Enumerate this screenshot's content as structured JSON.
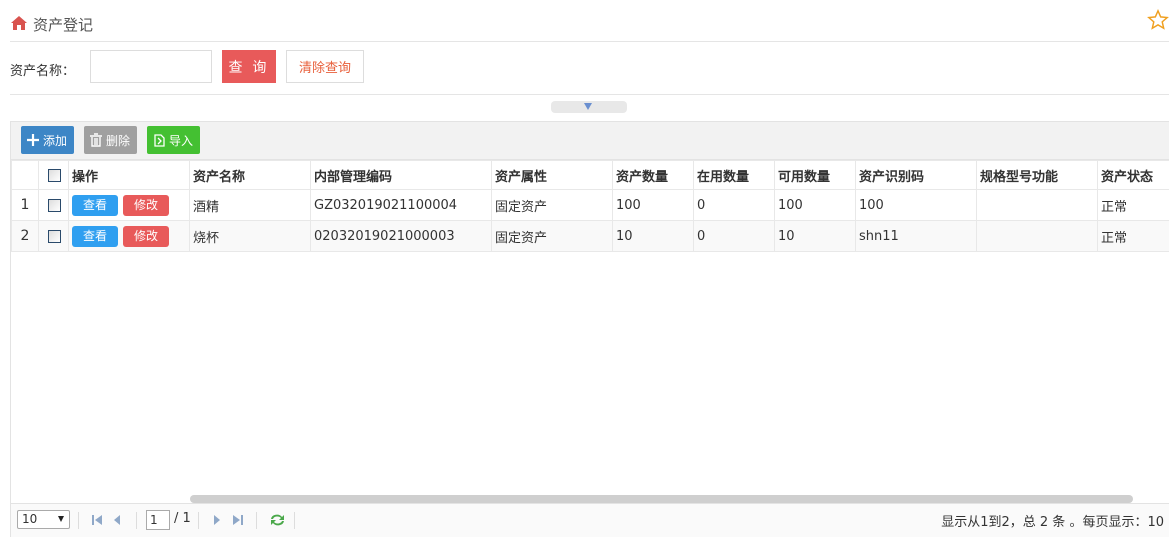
{
  "header": {
    "title": "资产登记",
    "home_icon": "home-icon",
    "favorite_icon": "star-icon",
    "accent_color": "#e85a5a"
  },
  "search": {
    "label": "资产名称：",
    "input_value": "",
    "input_placeholder": "",
    "query_label": "查 询",
    "clear_label": "清除查询"
  },
  "toolbar": {
    "add_label": "添加",
    "delete_label": "删除",
    "import_label": "导入"
  },
  "table": {
    "columns": [
      "",
      "",
      "操作",
      "资产名称",
      "内部管理编码",
      "资产属性",
      "资产数量",
      "在用数量",
      "可用数量",
      "资产识别码",
      "规格型号功能",
      "资产状态"
    ],
    "view_label": "查看",
    "edit_label": "修改",
    "rows": [
      {
        "index": "1",
        "name": "酒精",
        "code": "GZ032019021100004",
        "attr": "固定资产",
        "qty": "100",
        "in_use": "0",
        "available": "100",
        "ident": "100",
        "spec": "",
        "status": "正常"
      },
      {
        "index": "2",
        "name": "烧杯",
        "code": "02032019021000003",
        "attr": "固定资产",
        "qty": "10",
        "in_use": "0",
        "available": "10",
        "ident": "shn11",
        "spec": "",
        "status": "正常"
      }
    ]
  },
  "pager": {
    "page_size": "10",
    "current_page": "1",
    "total_pages": "/ 1",
    "info": "显示从1到2，总 2 条 。每页显示：10"
  }
}
